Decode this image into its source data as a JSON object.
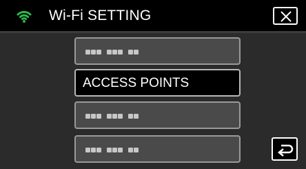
{
  "header": {
    "title": "Wi-Fi SETTING",
    "wifi_icon": "wifi-icon",
    "close_icon": "close-icon"
  },
  "menu": {
    "items": [
      {
        "label": "",
        "obscured": true
      },
      {
        "label": "ACCESS POINTS",
        "selected": true
      },
      {
        "label": "",
        "obscured": true
      },
      {
        "label": "",
        "obscured": true
      }
    ]
  },
  "footer": {
    "back_icon": "return-icon"
  },
  "colors": {
    "wifi_green": "#2db84a",
    "background": "#000000",
    "panel": "#2b2b2b",
    "button": "#4a4a4a"
  }
}
